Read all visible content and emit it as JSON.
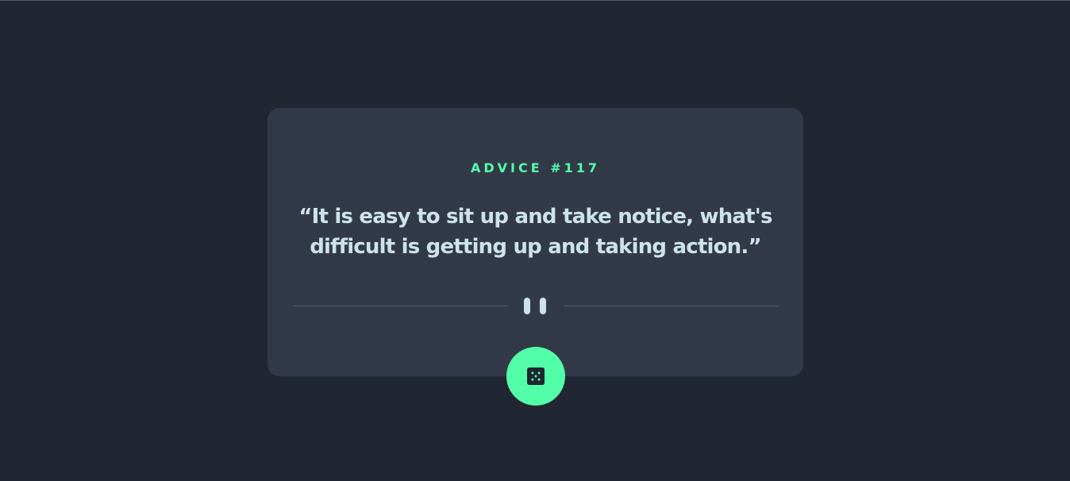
{
  "card": {
    "advice_label": "ADVICE #117",
    "quote": "“It is easy to sit up and take notice, what's difficult is getting up and taking action.”"
  },
  "divider": {
    "icon": "pause-icon"
  },
  "button": {
    "icon": "dice-icon",
    "accent_color": "#52ffa8"
  },
  "colors": {
    "background": "#202632",
    "card": "#323a49",
    "accent": "#52ffa8",
    "text": "#cee3e9"
  }
}
